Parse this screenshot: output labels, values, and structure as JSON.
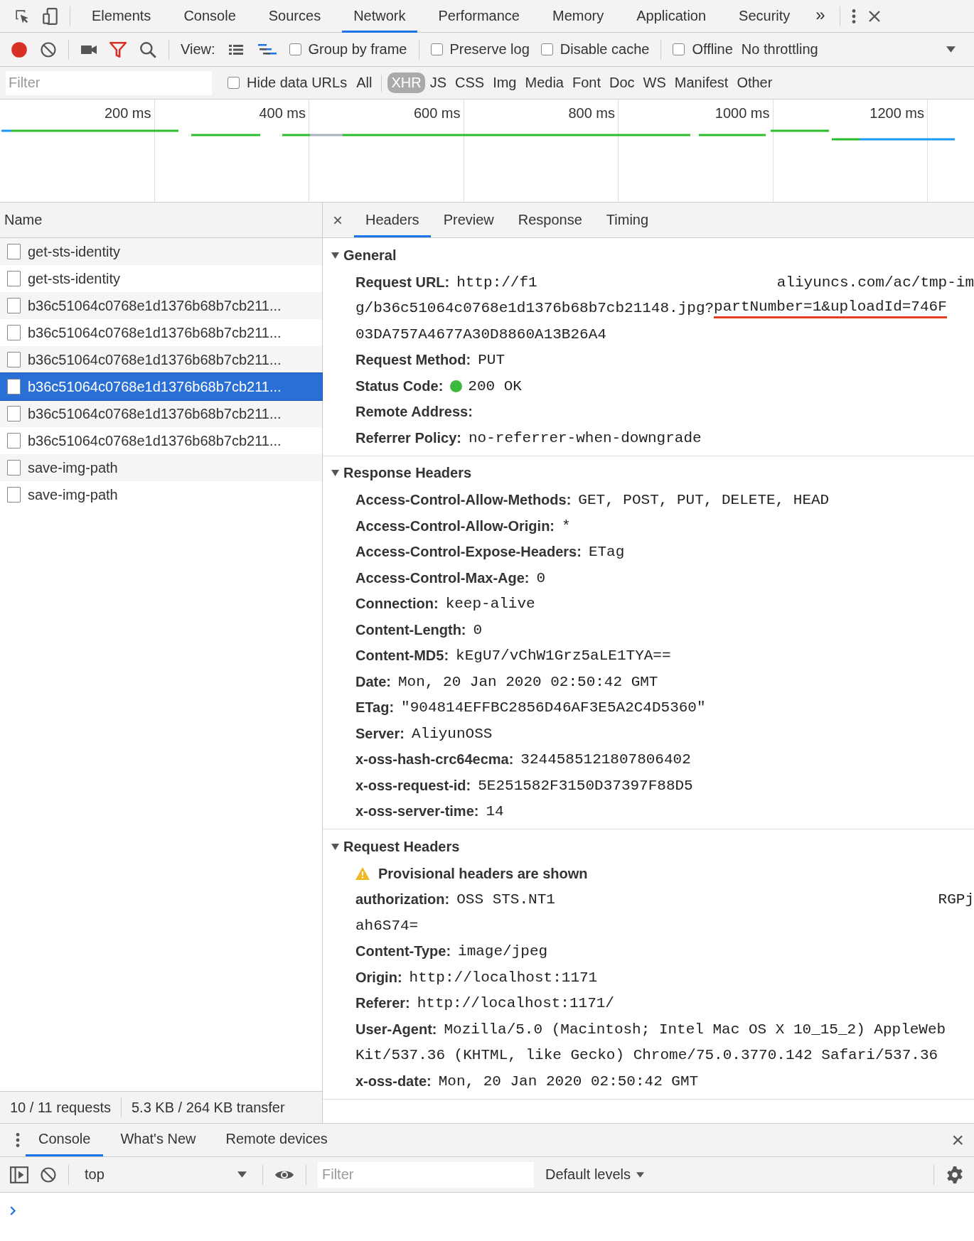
{
  "devtools_tabs": [
    {
      "label": "Elements",
      "selected": false
    },
    {
      "label": "Console",
      "selected": false
    },
    {
      "label": "Sources",
      "selected": false
    },
    {
      "label": "Network",
      "selected": true
    },
    {
      "label": "Performance",
      "selected": false
    },
    {
      "label": "Memory",
      "selected": false
    },
    {
      "label": "Application",
      "selected": false
    },
    {
      "label": "Security",
      "selected": false
    }
  ],
  "overflow_button": "»",
  "toolbar": {
    "recording": true,
    "view_label": "View:",
    "option_groups": [
      [
        {
          "label": "Group by frame",
          "checked": false
        }
      ],
      [
        {
          "label": "Preserve log",
          "checked": false
        },
        {
          "label": "Disable cache",
          "checked": false
        }
      ],
      [
        {
          "label": "Offline",
          "checked": false
        }
      ]
    ],
    "throttling": "No throttling"
  },
  "filter_bar": {
    "placeholder": "Filter",
    "hide_data_urls": {
      "label": "Hide data URLs",
      "checked": false
    },
    "types": [
      {
        "label": "All",
        "selected": false
      },
      {
        "label": "XHR",
        "selected": true
      },
      {
        "label": "JS",
        "selected": false
      },
      {
        "label": "CSS",
        "selected": false
      },
      {
        "label": "Img",
        "selected": false
      },
      {
        "label": "Media",
        "selected": false
      },
      {
        "label": "Font",
        "selected": false
      },
      {
        "label": "Doc",
        "selected": false
      },
      {
        "label": "WS",
        "selected": false
      },
      {
        "label": "Manifest",
        "selected": false
      },
      {
        "label": "Other",
        "selected": false
      }
    ]
  },
  "timeline": {
    "ticks": [
      "200 ms",
      "400 ms",
      "600 ms",
      "800 ms",
      "1000 ms",
      "1200 ms"
    ]
  },
  "requests": {
    "column": "Name",
    "rows": [
      {
        "name": "get-sts-identity",
        "selected": false
      },
      {
        "name": "get-sts-identity",
        "selected": false
      },
      {
        "name": "b36c51064c0768e1d1376b68b7cb211...",
        "selected": false
      },
      {
        "name": "b36c51064c0768e1d1376b68b7cb211...",
        "selected": false
      },
      {
        "name": "b36c51064c0768e1d1376b68b7cb211...",
        "selected": false
      },
      {
        "name": "b36c51064c0768e1d1376b68b7cb211...",
        "selected": true
      },
      {
        "name": "b36c51064c0768e1d1376b68b7cb211...",
        "selected": false
      },
      {
        "name": "b36c51064c0768e1d1376b68b7cb211...",
        "selected": false
      },
      {
        "name": "save-img-path",
        "selected": false
      },
      {
        "name": "save-img-path",
        "selected": false
      }
    ]
  },
  "status_bar": [
    "10 / 11 requests",
    "5.3 KB / 264 KB transfer"
  ],
  "detail_close": "×",
  "detail_tabs": [
    {
      "label": "Headers",
      "selected": true
    },
    {
      "label": "Preview",
      "selected": false
    },
    {
      "label": "Response",
      "selected": false
    },
    {
      "label": "Timing",
      "selected": false
    }
  ],
  "sections": [
    {
      "title": "General",
      "expanded": true,
      "rows": [
        {
          "kind": "header",
          "name": "Request URL:",
          "lines": [
            [
              {
                "text": "http://f1"
              },
              {
                "kind": "redacted"
              },
              {
                "text": "aliyuncs.com/ac/tmp-im"
              }
            ],
            [
              {
                "text": "g/b36c51064c0768e1d1376b68b7cb21148.jpg?"
              },
              {
                "text": "partNumber=1&uploadId=746F",
                "underline": true
              }
            ],
            [
              {
                "text": "03DA757A4677A30D8860A13B26A4"
              }
            ]
          ]
        },
        {
          "kind": "header",
          "name": "Request Method:",
          "value": "PUT"
        },
        {
          "kind": "header",
          "name": "Status Code:",
          "value": "200 OK",
          "color": "#3cb93c"
        },
        {
          "kind": "header",
          "name": "Remote Address:",
          "lines": [
            [
              {
                "kind": "redacted"
              }
            ]
          ]
        },
        {
          "kind": "header",
          "name": "Referrer Policy:",
          "value": "no-referrer-when-downgrade"
        }
      ]
    },
    {
      "title": "Response Headers",
      "expanded": true,
      "rows": [
        {
          "kind": "header",
          "name": "Access-Control-Allow-Methods:",
          "value": "GET, POST, PUT, DELETE, HEAD"
        },
        {
          "kind": "header",
          "name": "Access-Control-Allow-Origin:",
          "value": "*"
        },
        {
          "kind": "header",
          "name": "Access-Control-Expose-Headers:",
          "value": "ETag"
        },
        {
          "kind": "header",
          "name": "Access-Control-Max-Age:",
          "value": "0"
        },
        {
          "kind": "header",
          "name": "Connection:",
          "value": "keep-alive"
        },
        {
          "kind": "header",
          "name": "Content-Length:",
          "value": "0"
        },
        {
          "kind": "header",
          "name": "Content-MD5:",
          "value": "kEgU7/vChW1Grz5aLE1TYA=="
        },
        {
          "kind": "header",
          "name": "Date:",
          "value": "Mon, 20 Jan 2020 02:50:42 GMT"
        },
        {
          "kind": "header",
          "name": "ETag:",
          "value": "\"904814EFFBC2856D46AF3E5A2C4D5360\""
        },
        {
          "kind": "header",
          "name": "Server:",
          "value": "AliyunOSS"
        },
        {
          "kind": "header",
          "name": "x-oss-hash-crc64ecma:",
          "value": "3244585121807806402"
        },
        {
          "kind": "header",
          "name": "x-oss-request-id:",
          "value": "5E251582F3150D37397F88D5"
        },
        {
          "kind": "header",
          "name": "x-oss-server-time:",
          "value": "14"
        }
      ]
    },
    {
      "title": "Request Headers",
      "expanded": true,
      "rows": [
        {
          "kind": "notice",
          "text": "Provisional headers are shown"
        },
        {
          "kind": "header",
          "name": "authorization:",
          "lines": [
            [
              {
                "text": "OSS STS.NT1"
              },
              {
                "kind": "redacted"
              },
              {
                "text": "RGPj"
              }
            ],
            [
              {
                "text": "ah6S74="
              }
            ]
          ]
        },
        {
          "kind": "header",
          "name": "Content-Type:",
          "value": "image/jpeg"
        },
        {
          "kind": "header",
          "name": "Origin:",
          "value": "http://localhost:1171"
        },
        {
          "kind": "header",
          "name": "Referer:",
          "value": "http://localhost:1171/"
        },
        {
          "kind": "header",
          "name": "User-Agent:",
          "lines": [
            [
              {
                "text": "Mozilla/5.0 (Macintosh; Intel Mac OS X 10_15_2) AppleWeb"
              }
            ],
            [
              {
                "text": "Kit/537.36 (KHTML, like Gecko) Chrome/75.0.3770.142 Safari/537.36"
              }
            ]
          ]
        },
        {
          "kind": "header",
          "name": "x-oss-date:",
          "value": "Mon, 20 Jan 2020 02:50:42 GMT"
        }
      ]
    }
  ],
  "drawer": {
    "tabs": [
      {
        "label": "Console",
        "selected": true
      },
      {
        "label": "What's New",
        "selected": false
      },
      {
        "label": "Remote devices",
        "selected": false
      }
    ],
    "close": "×",
    "context": "top",
    "filter_placeholder": "Filter",
    "levels": "Default levels"
  }
}
